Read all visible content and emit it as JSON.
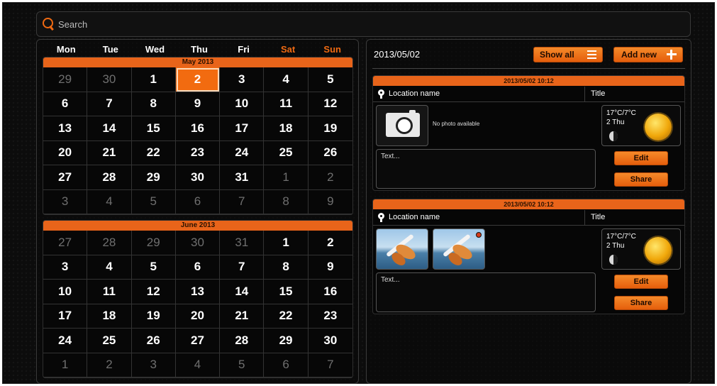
{
  "search": {
    "placeholder": "Search"
  },
  "calendar": {
    "weekdays": [
      "Mon",
      "Tue",
      "Wed",
      "Thu",
      "Fri",
      "Sat",
      "Sun"
    ],
    "months": [
      {
        "title": "May 2013",
        "days": [
          "29",
          "30",
          "1",
          "2",
          "3",
          "4",
          "5",
          "6",
          "7",
          "8",
          "9",
          "10",
          "11",
          "12",
          "13",
          "14",
          "15",
          "16",
          "17",
          "18",
          "19",
          "20",
          "21",
          "22",
          "23",
          "24",
          "25",
          "26",
          "27",
          "28",
          "29",
          "30",
          "31",
          "1",
          "2",
          "3",
          "4",
          "5",
          "6",
          "7",
          "8",
          "9"
        ],
        "out_of_month_indexes": [
          0,
          1,
          33,
          34,
          35,
          36,
          37,
          38,
          39,
          40,
          41
        ],
        "selected_index": 3
      },
      {
        "title": "June 2013",
        "days": [
          "27",
          "28",
          "29",
          "30",
          "31",
          "1",
          "2",
          "3",
          "4",
          "5",
          "6",
          "7",
          "8",
          "9",
          "10",
          "11",
          "12",
          "13",
          "14",
          "15",
          "16",
          "17",
          "18",
          "19",
          "20",
          "21",
          "22",
          "23",
          "24",
          "25",
          "26",
          "27",
          "28",
          "29",
          "30",
          "1",
          "2",
          "3",
          "4",
          "5",
          "6",
          "7"
        ],
        "out_of_month_indexes": [
          0,
          1,
          2,
          3,
          4,
          35,
          36,
          37,
          38,
          39,
          40,
          41
        ],
        "selected_index": -1
      }
    ]
  },
  "diary": {
    "date": "2013/05/02",
    "show_all_label": "Show all",
    "add_new_label": "Add new",
    "entries": [
      {
        "timestamp": "2013/05/02 10:12",
        "location": "Location name",
        "title": "Title",
        "photo_note": "No photo available",
        "temperature": "17°C/7°C",
        "day": "2 Thu",
        "text_placeholder": "Text...",
        "edit_label": "Edit",
        "share_label": "Share"
      },
      {
        "timestamp": "2013/05/02 10:12",
        "location": "Location name",
        "title": "Title",
        "temperature": "17°C/7°C",
        "day": "2 Thu",
        "text_placeholder": "Text...",
        "edit_label": "Edit",
        "share_label": "Share"
      }
    ]
  },
  "colors": {
    "accent": "#f06a12",
    "background": "#0c0c0c",
    "out_of_month": "#6f6f6f"
  }
}
